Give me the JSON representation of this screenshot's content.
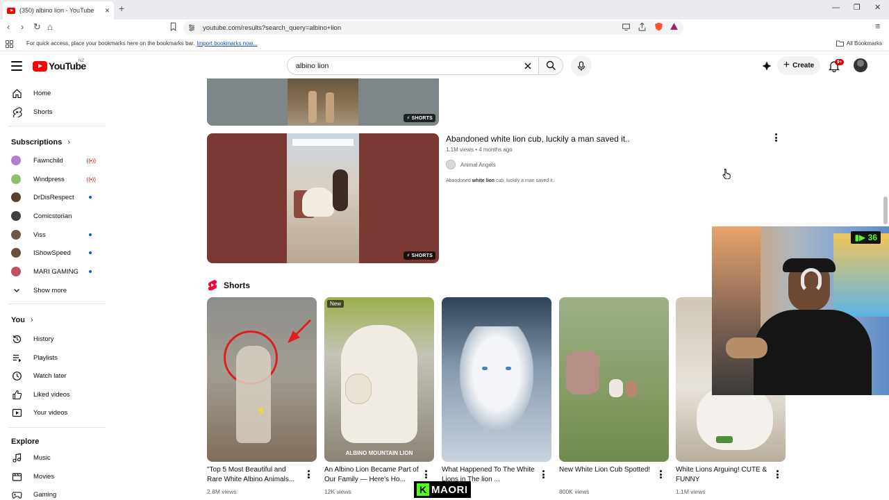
{
  "browser": {
    "tab_title": "(350) albino lion - YouTube",
    "url": "youtube.com/results?search_query=albino+lion",
    "bookmarks_hint": "For quick access, place your bookmarks here on the bookmarks bar.",
    "import_link": "Import bookmarks now...",
    "all_bookmarks": "All Bookmarks"
  },
  "masthead": {
    "logo_text": "YouTube",
    "country": "NZ",
    "search_value": "albino lion",
    "create_label": "Create",
    "notif_count": "9+"
  },
  "sidebar": {
    "main": [
      {
        "label": "Home",
        "icon": "home-icon"
      },
      {
        "label": "Shorts",
        "icon": "shorts-icon"
      }
    ],
    "subscriptions_heading": "Subscriptions",
    "subscriptions": [
      {
        "label": "Fawnchild",
        "status": "live",
        "color": "#b07fd0"
      },
      {
        "label": "Windpress",
        "status": "live",
        "color": "#8fbf6a"
      },
      {
        "label": "DrDisRespect",
        "status": "new",
        "color": "#5a4030"
      },
      {
        "label": "Comicstorian",
        "status": "",
        "color": "#404040"
      },
      {
        "label": "Viss",
        "status": "new",
        "color": "#705848"
      },
      {
        "label": "IShowSpeed",
        "status": "new",
        "color": "#6a5040"
      },
      {
        "label": "MARI GAMING",
        "status": "new",
        "color": "#c05060"
      }
    ],
    "show_more": "Show more",
    "you_heading": "You",
    "you_items": [
      {
        "label": "History",
        "icon": "history-icon"
      },
      {
        "label": "Playlists",
        "icon": "playlists-icon"
      },
      {
        "label": "Watch later",
        "icon": "clock-icon"
      },
      {
        "label": "Liked videos",
        "icon": "thumbs-up-icon"
      },
      {
        "label": "Your videos",
        "icon": "play-square-icon"
      }
    ],
    "explore_heading": "Explore",
    "explore_items": [
      {
        "label": "Music",
        "icon": "music-icon"
      },
      {
        "label": "Movies",
        "icon": "movies-icon"
      },
      {
        "label": "Gaming",
        "icon": "gaming-icon"
      }
    ]
  },
  "results": {
    "shorts_pill": "SHORTS",
    "video": {
      "title": "Abandoned white lion cub, luckily a man saved it..",
      "meta": "1.1M views • 4 months ago",
      "channel": "Animal Angels",
      "desc_pre": "Abandoned ",
      "desc_bold": "white lion",
      "desc_post": " cub, luckily a man saved it.."
    },
    "shorts_heading": "Shorts",
    "shorts": [
      {
        "title": "\"Top 5 Most Beautiful and Rare White Albino Animals...",
        "views": "2.8M views"
      },
      {
        "title": "An Albino Lion Became Part of Our Family — Here's Ho...",
        "views": "12K views",
        "badge": "New",
        "overlay": "ALBINO MOUNTAIN LION"
      },
      {
        "title": "What Happened To The White Lions in The lion ...",
        "views": ""
      },
      {
        "title": "New White Lion Cub Spotted!",
        "views": "800K views"
      },
      {
        "title": "White Lions Arguing! CUTE & FUNNY",
        "views": "1.1M views"
      }
    ]
  },
  "overlay": {
    "kick_count": "36",
    "tag_letter": "K",
    "tag_text": "MAORI",
    "thumb_number": "5"
  },
  "colors": {
    "youtube_red": "#ff0000",
    "kick_green": "#53fc18",
    "link_blue": "#065fd4"
  }
}
